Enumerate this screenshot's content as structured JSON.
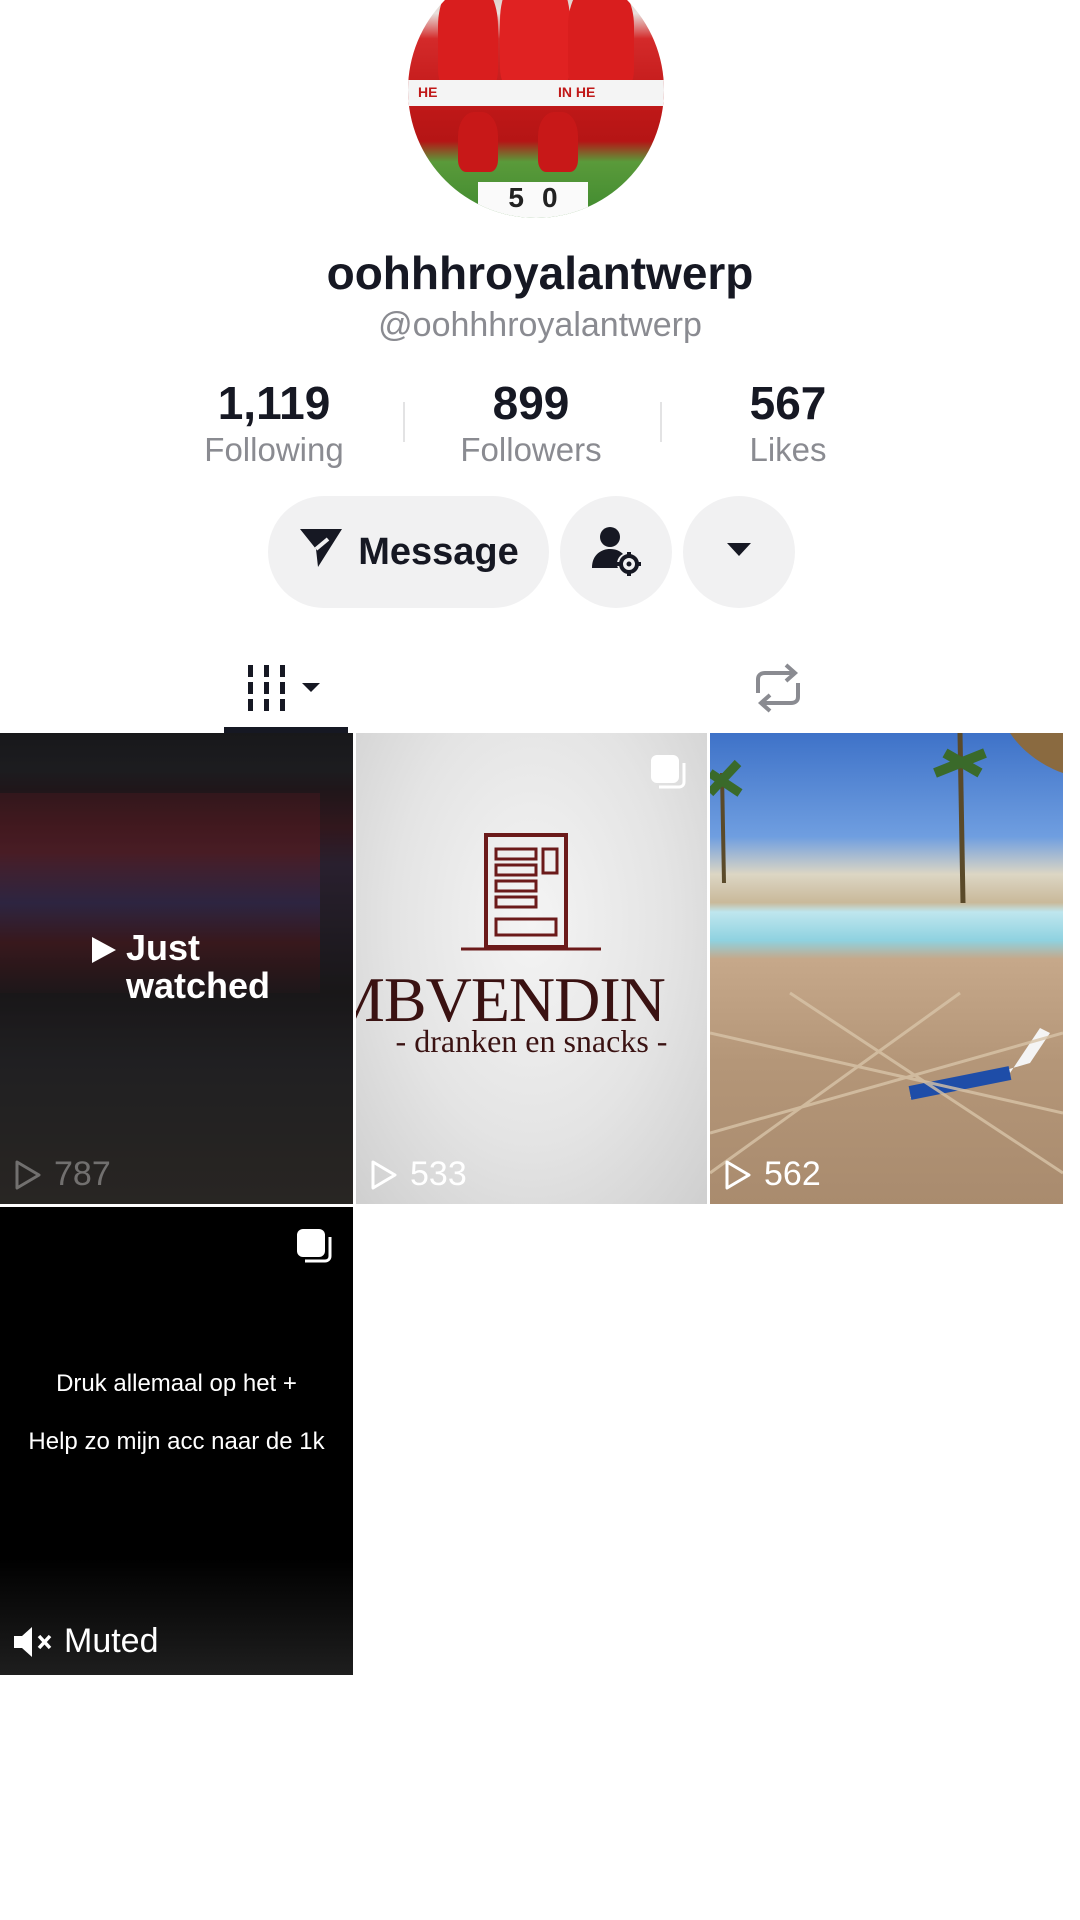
{
  "profile": {
    "display_name": "oohhhroyalantwerp",
    "handle": "@oohhhroyalantwerp",
    "avatar_score_home": "5",
    "avatar_score_away": "0"
  },
  "stats": {
    "following": {
      "value": "1,119",
      "label": "Following"
    },
    "followers": {
      "value": "899",
      "label": "Followers"
    },
    "likes": {
      "value": "567",
      "label": "Likes"
    }
  },
  "actions": {
    "message_label": "Message"
  },
  "videos": [
    {
      "overlay": "Just watched",
      "views": "787"
    },
    {
      "brand_text": "MBVENDIN",
      "brand_sub": "- dranken en snacks -",
      "views": "533"
    },
    {
      "views": "562"
    },
    {
      "caption_line1": "Druk allemaal op het +",
      "caption_line2": "Help zo mijn acc naar de 1k",
      "muted_label": "Muted"
    }
  ],
  "colors": {
    "text_primary": "#161823",
    "text_secondary": "#8a8b91",
    "button_bg": "#f1f1f2"
  }
}
